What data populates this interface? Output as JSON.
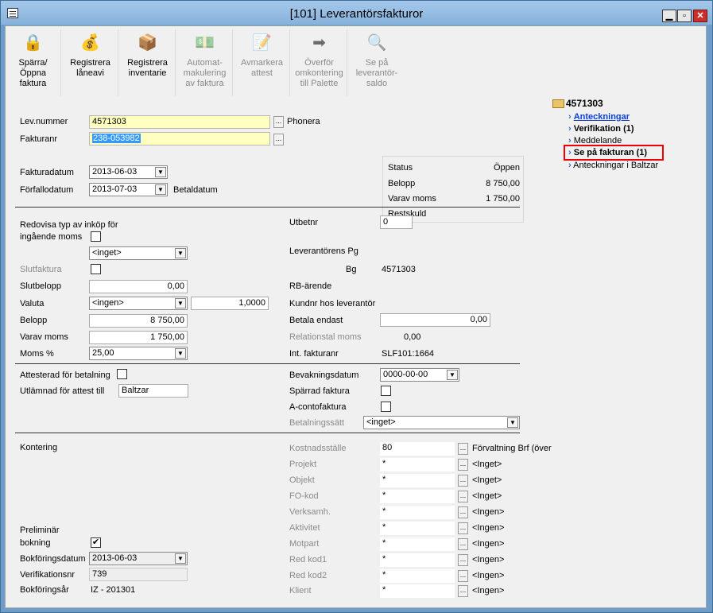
{
  "window": {
    "title": "[101]  Leverantörsfakturor",
    "min_label": "▁",
    "max_label": "▫",
    "close_label": "✕"
  },
  "toolbar": [
    {
      "label": "Spärra/\nÖppna\nfaktura",
      "icon": "lock-icon",
      "enabled": true
    },
    {
      "label": "Registrera\nlåneavi",
      "icon": "money-icon",
      "enabled": true
    },
    {
      "label": "Registrera\ninventarie",
      "icon": "inventory-icon",
      "enabled": true
    },
    {
      "label": "Automat-\nmakulering\nav faktura",
      "icon": "auto-void-icon",
      "enabled": false
    },
    {
      "label": "Avmarkera\nattest",
      "icon": "unmark-attest-icon",
      "enabled": false
    },
    {
      "label": "Överför\nomkontering\ntill Palette",
      "icon": "transfer-icon",
      "enabled": false
    },
    {
      "label": "Se på\nleverantör-\nsaldo",
      "icon": "search-icon",
      "enabled": false
    }
  ],
  "header": {
    "levnummer_label": "Lev.nummer",
    "levnummer": "4571303",
    "phone_label": "Phonera",
    "fakturanr_label": "Fakturanr",
    "fakturanr": "238-053982",
    "fakturadatum_label": "Fakturadatum",
    "fakturadatum": "2013-06-03",
    "forfallodatum_label": "Förfallodatum",
    "forfallodatum": "2013-07-03",
    "betaldatum_label": "Betaldatum",
    "ellipsis": "..."
  },
  "status": {
    "status_label": "Status",
    "status_value": "Öppen",
    "belopp_label": "Belopp",
    "belopp_value": "8 750,00",
    "varav_label": "Varav moms",
    "varav_value": "1 750,00",
    "rest_label": "Restskuld"
  },
  "tree": {
    "root": "4571303",
    "items": [
      {
        "label": "Anteckningar",
        "style": "link"
      },
      {
        "label": "Verifikation (1)",
        "style": "bold"
      },
      {
        "label": "Meddelande",
        "style": "normal"
      },
      {
        "label": "Se på fakturan (1)",
        "style": "bold"
      },
      {
        "label": "Anteckningar i Baltzar",
        "style": "normal"
      }
    ]
  },
  "left": {
    "redovisa_label1": "Redovisa typ av inköp för",
    "redovisa_label2": "ingående moms",
    "inget_value": "<inget>",
    "slutfaktura_label": "Slutfaktura",
    "slutbelopp_label": "Slutbelopp",
    "slutbelopp": "0,00",
    "valuta_label": "Valuta",
    "valuta": "<ingen>",
    "kurs": "1,0000",
    "belopp_label": "Belopp",
    "belopp": "8 750,00",
    "varav_label": "Varav moms",
    "varav": "1 750,00",
    "moms_label": "Moms %",
    "moms": "25,00"
  },
  "right": {
    "utbetnr_label": "Utbetnr",
    "utbetnr": "0",
    "pg_label": "Leverantörens Pg",
    "bg_label": "Bg",
    "bg_value": "4571303",
    "rb_label": "RB-ärende",
    "kundnr_label": "Kundnr hos leverantör",
    "betala_label": "Betala endast",
    "betala": "0,00",
    "relation_label": "Relationstal moms",
    "relation": "0,00",
    "intfakt_label": "Int. fakturanr",
    "intfakt": "SLF101:1664"
  },
  "attest": {
    "attesterad_label": "Attesterad för betalning",
    "utlamnad_label": "Utlämnad för attest till",
    "utlamnad": "Baltzar",
    "bevakning_label": "Bevakningsdatum",
    "bevakning": "0000-00-00",
    "sparrad_label": "Spärrad faktura",
    "aconto_label": "A-contofaktura",
    "betalsatt_label": "Betalningssätt",
    "betalsatt": "<inget>"
  },
  "kontering": {
    "label": "Kontering",
    "prelim1": "Preliminär",
    "prelim2": "bokning",
    "prelim_checked": "✔",
    "bokdatum_label": "Bokföringsdatum",
    "bokdatum": "2013-06-03",
    "verifnr_label": "Verifikationsnr",
    "verifnr": "739",
    "bokar_label": "Bokföringsår",
    "bokar": "IZ - 201301",
    "rows": [
      {
        "label": "Kostnadsställe",
        "value": "80",
        "desc": "Förvaltning Brf (över"
      },
      {
        "label": "Projekt",
        "value": "*",
        "desc": "<Inget>"
      },
      {
        "label": "Objekt",
        "value": "*",
        "desc": "<Inget>"
      },
      {
        "label": "FO-kod",
        "value": "*",
        "desc": "<Inget>"
      },
      {
        "label": "Verksamh.",
        "value": "*",
        "desc": "<Ingen>"
      },
      {
        "label": "Aktivitet",
        "value": "*",
        "desc": "<Ingen>"
      },
      {
        "label": "Motpart",
        "value": "*",
        "desc": "<Ingen>"
      },
      {
        "label": "Red kod1",
        "value": "*",
        "desc": "<Ingen>"
      },
      {
        "label": "Red kod2",
        "value": "*",
        "desc": "<Ingen>"
      },
      {
        "label": "Klient",
        "value": "*",
        "desc": "<Ingen>"
      }
    ]
  }
}
